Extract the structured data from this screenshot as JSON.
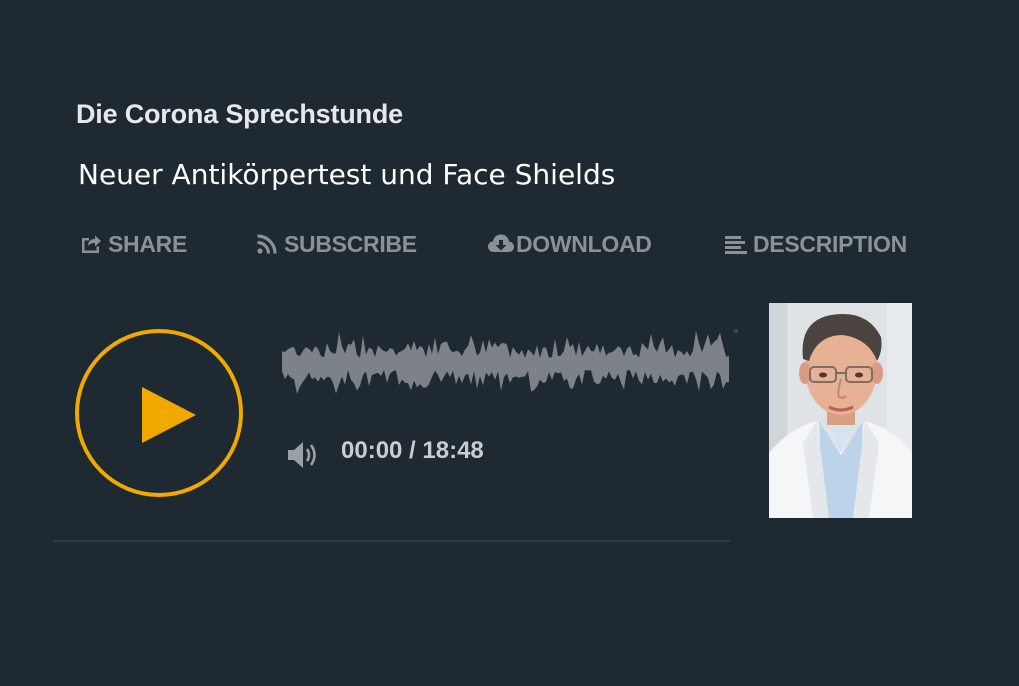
{
  "player": {
    "podcast_title": "Die Corona Sprechstunde",
    "episode_title": "Neuer Antikörpertest und Face Shields",
    "actions": [
      {
        "label": "SHARE",
        "icon": "share-icon"
      },
      {
        "label": "SUBSCRIBE",
        "icon": "rss-icon"
      },
      {
        "label": "DOWNLOAD",
        "icon": "cloud-download-icon"
      },
      {
        "label": "DESCRIPTION",
        "icon": "text-lines-icon"
      }
    ],
    "time": {
      "current": "00:00",
      "total": "18:48",
      "display": "00:00 / 18:48"
    },
    "playback_progress": 0,
    "cover_alt": "Portrait photo of the host"
  },
  "colors": {
    "background": "#1e2932",
    "accent": "#f1a900",
    "action_text": "#8a9197",
    "waveform": "#7c8287",
    "title_text": "#e6e8e9"
  }
}
